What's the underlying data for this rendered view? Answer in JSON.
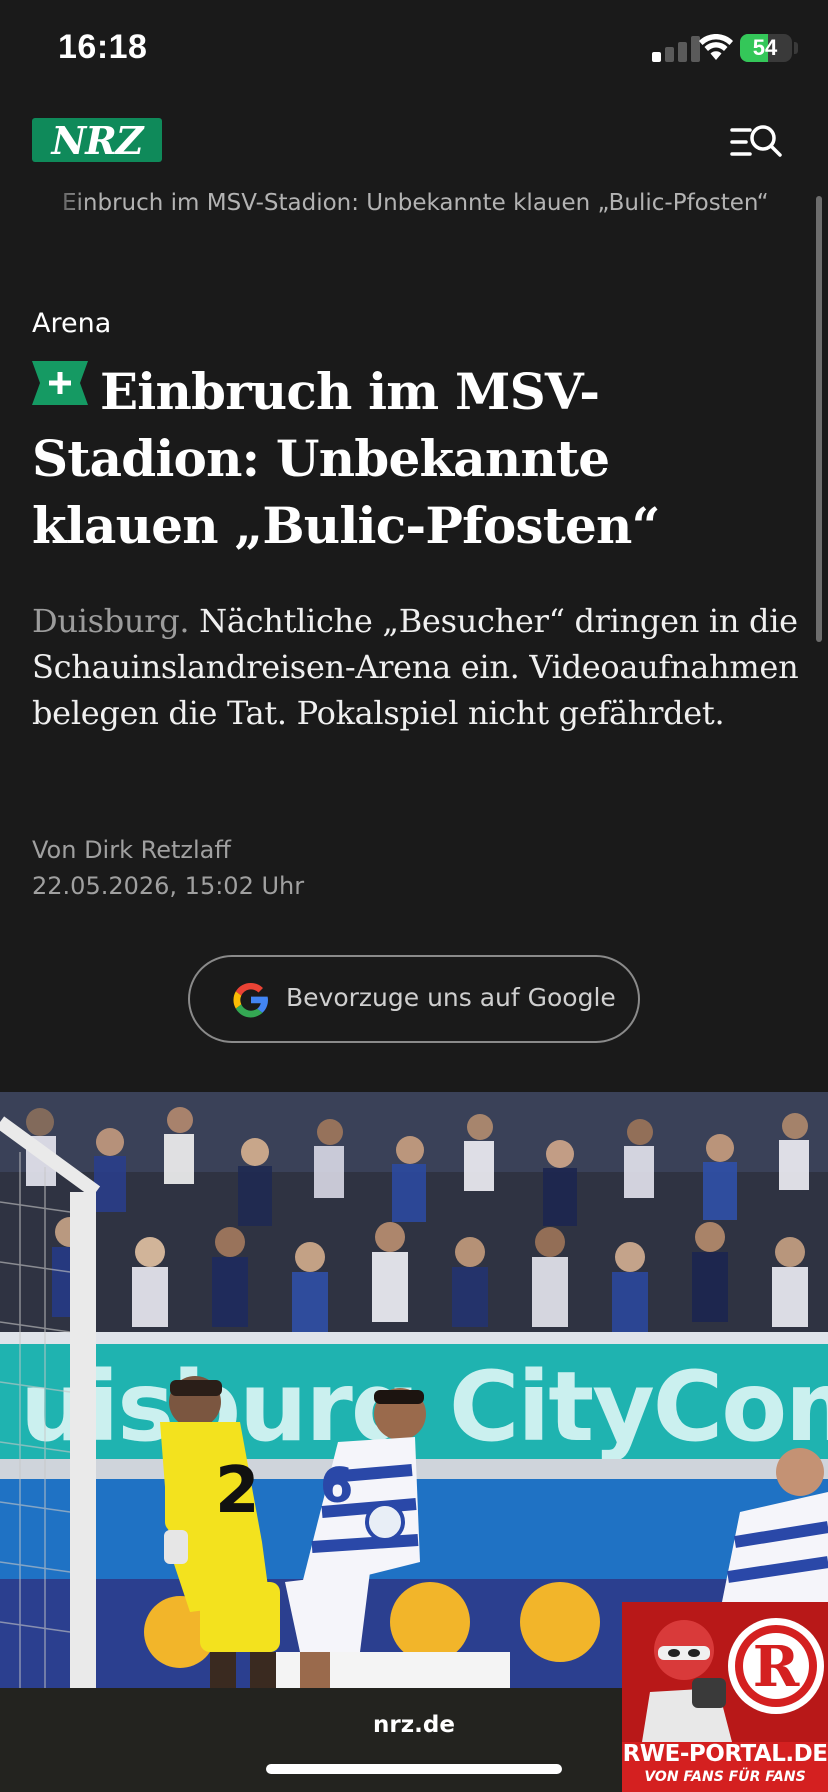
{
  "status_bar": {
    "time": "16:18",
    "battery_percent": 54,
    "battery_label": "54",
    "signal_bars_active": 1,
    "signal_bars_total": 4,
    "charging": true
  },
  "header": {
    "logo_text": "NRZ",
    "logo_color": "#0f8a5a",
    "menu_icon": "menu-search-icon"
  },
  "ticker": {
    "text": "Einbruch im MSV-Stadion: Unbekannte klauen „Bulic-Pfosten“"
  },
  "article": {
    "category": "Arena",
    "premium_icon": "plus-icon",
    "headline": "Einbruch im MSV-Stadion: Unbekannte klauen „Bulic-Pfosten“",
    "dateline": "Duisburg.",
    "teaser": "Nächtliche „Besucher“ dringen in die Schauinslandreisen-Arena ein. Videoaufnahmen belegen die Tat. Pokalspiel nicht gefährdet.",
    "author": "Von Dirk Retzlaff",
    "date": "22.05.2026, 15:02 Uhr"
  },
  "google_button": {
    "label": "Bevorzuge uns auf Google",
    "icon": "google-icon"
  },
  "photo": {
    "banner_text": "uisburg CityCom",
    "player_numbers": [
      "2",
      "6"
    ]
  },
  "ad": {
    "title": "RWE-PORTAL.DE",
    "subtitle": "VON FANS FÜR FANS",
    "logo_letters": "RWE"
  },
  "browser": {
    "url": "nrz.de"
  }
}
